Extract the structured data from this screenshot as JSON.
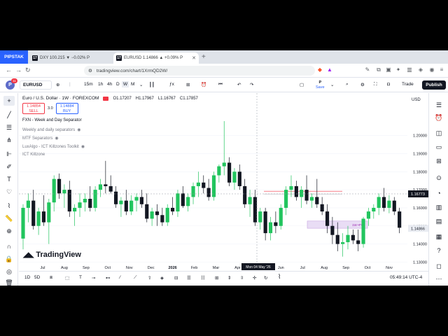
{
  "browser": {
    "profile_label": "PIPSTAK",
    "tabs": [
      {
        "label": "DXY 100.215 ▼ −0.02% P",
        "favicon": "17"
      },
      {
        "label": "EURUSD 1.14866 ▲ +0.09% P",
        "favicon": "17"
      }
    ],
    "url": "tradingview.com/chart/1XrmQD2W/",
    "new_tab": "+"
  },
  "toolbar": {
    "avatar_letter": "P",
    "avatar_badge": "11",
    "symbol": "EURUSD",
    "intervals": [
      "15m",
      "1h",
      "4h",
      "D",
      "W",
      "M"
    ],
    "active_interval": "W",
    "save_top": "P",
    "save_label": "Save",
    "trade_label": "Trade",
    "publish_label": "Publish"
  },
  "legend": {
    "title": "Euro / U.S. Dollar · 1W · FOREXCOM",
    "open": "O1.17207",
    "high": "H1.17967",
    "low": "L1.16767",
    "close": "C1.17857",
    "sell_price": "1.14854",
    "sell_label": "SELL",
    "buy_price": "1.14884",
    "buy_label": "BUY",
    "spread": "3.0"
  },
  "indicators": [
    "FXN - Week and Day Separator",
    "Weekly and daily separators",
    "MTF Separators",
    "LuxAlgo - ICT Killzones Toolkit",
    "ICT Killzone"
  ],
  "branding": {
    "name": "TradingView"
  },
  "chart_data": {
    "type": "candlestick",
    "currency": "USD",
    "y_ticks": [
      1.2,
      1.19,
      1.18,
      1.17,
      1.16,
      1.15,
      1.14,
      1.13
    ],
    "ylim": [
      1.1255,
      1.2235
    ],
    "x_ticks": [
      "Jul",
      "Aug",
      "Sep",
      "Oct",
      "Nov",
      "Dec",
      "2026",
      "Feb",
      "Mar",
      "Apr",
      "May",
      "Jun",
      "Jul",
      "Aug",
      "Sep",
      "Oct",
      "Nov"
    ],
    "crosshair_price": "1.16773",
    "crosshair_date": "Mon 04 May '26",
    "last_price": "1.14866",
    "fvg_label": "1W •FVG",
    "colors": {
      "up": "#22c55e",
      "down": "#131722",
      "fvg": "#c7a4e0",
      "hline": "#f23645"
    },
    "candles": [
      [
        1.143,
        1.162,
        1.137,
        1.16
      ],
      [
        1.16,
        1.168,
        1.152,
        1.164
      ],
      [
        1.164,
        1.17,
        1.148,
        1.15
      ],
      [
        1.15,
        1.16,
        1.145,
        1.158
      ],
      [
        1.158,
        1.167,
        1.15,
        1.152
      ],
      [
        1.152,
        1.165,
        1.14,
        1.163
      ],
      [
        1.163,
        1.178,
        1.158,
        1.176
      ],
      [
        1.176,
        1.179,
        1.165,
        1.168
      ],
      [
        1.168,
        1.173,
        1.16,
        1.17
      ],
      [
        1.17,
        1.175,
        1.155,
        1.158
      ],
      [
        1.158,
        1.162,
        1.15,
        1.16
      ],
      [
        1.16,
        1.168,
        1.155,
        1.163
      ],
      [
        1.163,
        1.168,
        1.158,
        1.165
      ],
      [
        1.165,
        1.172,
        1.158,
        1.16
      ],
      [
        1.16,
        1.172,
        1.158,
        1.17
      ],
      [
        1.17,
        1.176,
        1.166,
        1.173
      ],
      [
        1.173,
        1.186,
        1.168,
        1.172
      ],
      [
        1.172,
        1.178,
        1.168,
        1.169
      ],
      [
        1.169,
        1.172,
        1.16,
        1.162
      ],
      [
        1.162,
        1.166,
        1.155,
        1.164
      ],
      [
        1.164,
        1.17,
        1.156,
        1.158
      ],
      [
        1.158,
        1.167,
        1.156,
        1.164
      ],
      [
        1.164,
        1.168,
        1.158,
        1.166
      ],
      [
        1.166,
        1.17,
        1.16,
        1.162
      ],
      [
        1.162,
        1.168,
        1.152,
        1.154
      ],
      [
        1.154,
        1.16,
        1.15,
        1.158
      ],
      [
        1.158,
        1.162,
        1.15,
        1.156
      ],
      [
        1.156,
        1.16,
        1.15,
        1.152
      ],
      [
        1.152,
        1.162,
        1.15,
        1.16
      ],
      [
        1.16,
        1.166,
        1.156,
        1.158
      ],
      [
        1.158,
        1.17,
        1.155,
        1.168
      ],
      [
        1.168,
        1.172,
        1.16,
        1.161
      ],
      [
        1.161,
        1.168,
        1.158,
        1.166
      ],
      [
        1.166,
        1.174,
        1.162,
        1.172
      ],
      [
        1.172,
        1.18,
        1.166,
        1.174
      ],
      [
        1.174,
        1.178,
        1.168,
        1.171
      ],
      [
        1.171,
        1.176,
        1.164,
        1.166
      ],
      [
        1.166,
        1.18,
        1.164,
        1.178
      ],
      [
        1.178,
        1.184,
        1.174,
        1.183
      ],
      [
        1.183,
        1.208,
        1.178,
        1.185
      ],
      [
        1.185,
        1.188,
        1.172,
        1.174
      ],
      [
        1.174,
        1.182,
        1.17,
        1.18
      ],
      [
        1.18,
        1.184,
        1.17,
        1.172
      ],
      [
        1.172,
        1.176,
        1.16,
        1.162
      ],
      [
        1.162,
        1.17,
        1.155,
        1.166
      ],
      [
        1.166,
        1.17,
        1.15,
        1.152
      ],
      [
        1.152,
        1.16,
        1.148,
        1.158
      ],
      [
        1.158,
        1.16,
        1.142,
        1.146
      ],
      [
        1.146,
        1.155,
        1.142,
        1.152
      ],
      [
        1.152,
        1.158,
        1.146,
        1.15
      ],
      [
        1.15,
        1.162,
        1.148,
        1.16
      ],
      [
        1.16,
        1.172,
        1.156,
        1.17
      ],
      [
        1.17,
        1.178,
        1.166,
        1.172
      ],
      [
        1.172,
        1.175,
        1.164,
        1.166
      ],
      [
        1.166,
        1.172,
        1.16,
        1.17
      ],
      [
        1.17,
        1.178,
        1.162,
        1.164
      ],
      [
        1.164,
        1.168,
        1.16,
        1.166
      ],
      [
        1.166,
        1.176,
        1.16,
        1.162
      ],
      [
        1.162,
        1.166,
        1.156,
        1.158
      ],
      [
        1.158,
        1.162,
        1.146,
        1.15
      ],
      [
        1.15,
        1.155,
        1.14,
        1.145
      ],
      [
        1.145,
        1.152,
        1.136,
        1.14
      ],
      [
        1.14,
        1.146,
        1.133,
        1.141
      ],
      [
        1.141,
        1.15,
        1.137,
        1.145
      ],
      [
        1.145,
        1.148,
        1.14,
        1.142
      ],
      [
        1.142,
        1.148,
        1.136,
        1.14
      ],
      [
        1.14,
        1.155,
        1.138,
        1.154
      ],
      [
        1.154,
        1.16,
        1.15,
        1.158
      ],
      [
        1.158,
        1.162,
        1.154,
        1.16
      ],
      [
        1.16,
        1.168,
        1.156,
        1.166
      ],
      [
        1.166,
        1.171,
        1.158,
        1.16
      ],
      [
        1.16,
        1.167,
        1.157,
        1.164
      ],
      [
        1.164,
        1.166,
        1.156,
        1.158
      ],
      [
        1.158,
        1.16,
        1.146,
        1.149
      ]
    ]
  },
  "bottom": {
    "ranges": [
      "1D",
      "5D"
    ],
    "time": "05:49:14 UTC-4"
  }
}
